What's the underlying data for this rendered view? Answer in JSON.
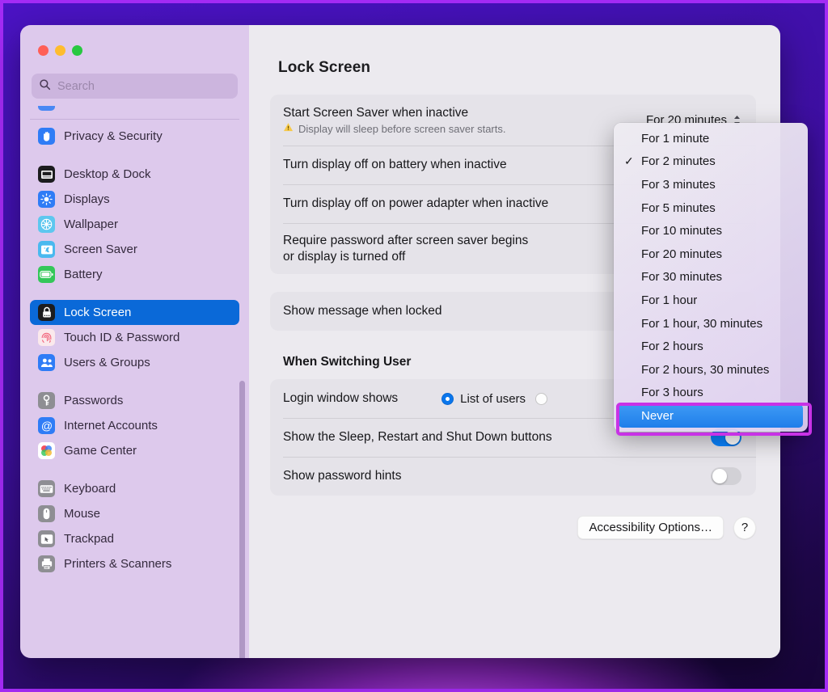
{
  "window": {
    "traffic_lights": [
      "close",
      "minimize",
      "zoom"
    ]
  },
  "search": {
    "placeholder": "Search",
    "value": "",
    "icon": "search-icon"
  },
  "sidebar": {
    "items": [
      {
        "label": "Privacy & Security",
        "icon": "hand-raised-icon",
        "icon_bg": "#2f7cf6",
        "selected": false,
        "gap_before": false
      },
      {
        "label": "Desktop & Dock",
        "icon": "dock-icon",
        "icon_bg": "#1c1c1e",
        "selected": false,
        "gap_before": true
      },
      {
        "label": "Displays",
        "icon": "brightness-icon",
        "icon_bg": "#2f7cf6",
        "selected": false,
        "gap_before": false
      },
      {
        "label": "Wallpaper",
        "icon": "wallpaper-icon",
        "icon_bg": "#5ec7ef",
        "selected": false,
        "gap_before": false
      },
      {
        "label": "Screen Saver",
        "icon": "screensaver-icon",
        "icon_bg": "#4ab9ef",
        "selected": false,
        "gap_before": false
      },
      {
        "label": "Battery",
        "icon": "battery-icon",
        "icon_bg": "#34c759",
        "selected": false,
        "gap_before": false
      },
      {
        "label": "Lock Screen",
        "icon": "lock-icon",
        "icon_bg": "#1c1c1e",
        "selected": true,
        "gap_before": true
      },
      {
        "label": "Touch ID & Password",
        "icon": "fingerprint-icon",
        "icon_bg": "#fbe9ec",
        "selected": false,
        "gap_before": false
      },
      {
        "label": "Users & Groups",
        "icon": "users-icon",
        "icon_bg": "#2f7cf6",
        "selected": false,
        "gap_before": false
      },
      {
        "label": "Passwords",
        "icon": "key-icon",
        "icon_bg": "#8e8e93",
        "selected": false,
        "gap_before": true
      },
      {
        "label": "Internet Accounts",
        "icon": "at-sign-icon",
        "icon_bg": "#2f7cf6",
        "selected": false,
        "gap_before": false
      },
      {
        "label": "Game Center",
        "icon": "game-center-icon",
        "icon_bg": "#ffffff",
        "selected": false,
        "gap_before": false
      },
      {
        "label": "Keyboard",
        "icon": "keyboard-icon",
        "icon_bg": "#8e8e93",
        "selected": false,
        "gap_before": true
      },
      {
        "label": "Mouse",
        "icon": "mouse-icon",
        "icon_bg": "#8e8e93",
        "selected": false,
        "gap_before": false
      },
      {
        "label": "Trackpad",
        "icon": "trackpad-icon",
        "icon_bg": "#8e8e93",
        "selected": false,
        "gap_before": false
      },
      {
        "label": "Printers & Scanners",
        "icon": "printer-icon",
        "icon_bg": "#8e8e93",
        "selected": false,
        "gap_before": false
      }
    ],
    "scrollbar": {
      "name": "sidebar-scrollbar"
    }
  },
  "main": {
    "title": "Lock Screen",
    "card1": {
      "rows": [
        {
          "label": "Start Screen Saver when inactive",
          "warning": "Display will sleep before screen saver starts.",
          "warning_icon": "warning-triangle-icon",
          "control": "popup",
          "value": "For 20 minutes"
        },
        {
          "label": "Turn display off on battery when inactive",
          "control": "popup",
          "value": ""
        },
        {
          "label": "Turn display off on power adapter when inactive",
          "control": "popup",
          "value": ""
        },
        {
          "label": "Require password after screen saver begins or display is turned off",
          "control": "popup",
          "value": ""
        }
      ]
    },
    "card2": {
      "rows": [
        {
          "label": "Show message when locked",
          "control": "popup",
          "value": ""
        }
      ]
    },
    "section_title": "When Switching User",
    "card3": {
      "rows": [
        {
          "label": "Login window shows",
          "control": "radio",
          "options": [
            {
              "label": "List of users",
              "selected": true
            },
            {
              "label": "",
              "selected": false
            }
          ]
        },
        {
          "label": "Show the Sleep, Restart and Shut Down buttons",
          "control": "toggle",
          "on": true
        },
        {
          "label": "Show password hints",
          "control": "toggle",
          "on": false
        }
      ]
    },
    "buttons": {
      "accessibility": "Accessibility Options…",
      "help": "?"
    }
  },
  "dropdown": {
    "open": true,
    "items": [
      {
        "label": "For 1 minute",
        "checked": false,
        "highlighted": false
      },
      {
        "label": "For 2 minutes",
        "checked": true,
        "highlighted": false
      },
      {
        "label": "For 3 minutes",
        "checked": false,
        "highlighted": false
      },
      {
        "label": "For 5 minutes",
        "checked": false,
        "highlighted": false
      },
      {
        "label": "For 10 minutes",
        "checked": false,
        "highlighted": false
      },
      {
        "label": "For 20 minutes",
        "checked": false,
        "highlighted": false
      },
      {
        "label": "For 30 minutes",
        "checked": false,
        "highlighted": false
      },
      {
        "label": "For 1 hour",
        "checked": false,
        "highlighted": false
      },
      {
        "label": "For 1 hour, 30 minutes",
        "checked": false,
        "highlighted": false
      },
      {
        "label": "For 2 hours",
        "checked": false,
        "highlighted": false
      },
      {
        "label": "For 2 hours, 30 minutes",
        "checked": false,
        "highlighted": false
      },
      {
        "label": "For 3 hours",
        "checked": false,
        "highlighted": false
      },
      {
        "label": "Never",
        "checked": false,
        "highlighted": true
      }
    ],
    "check_glyph": "✓"
  },
  "annotation": {
    "color": "#c832e6",
    "target": "Never"
  },
  "colors": {
    "accent_blue": "#0a69d8",
    "toggle_on": "#0a84ff",
    "annotation_magenta": "#c832e6",
    "wallpaper_purple": "#4311b4",
    "frame_purple": "#a42bf5"
  }
}
